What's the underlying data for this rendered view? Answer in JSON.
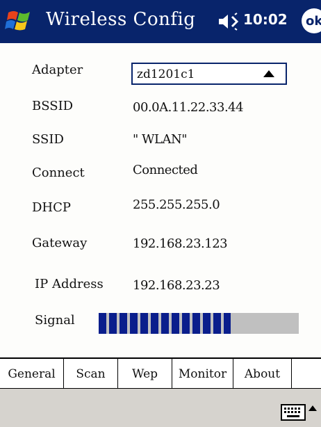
{
  "titlebar": {
    "title": "Wireless Config",
    "time": "10:02",
    "ok_label": "ok",
    "icons": [
      "windows-start-icon",
      "speaker-icon"
    ],
    "accent_color": "#08246b"
  },
  "form": {
    "adapter": {
      "label": "Adapter",
      "value": "zd1201c1"
    },
    "bssid": {
      "label": "BSSID",
      "value": "00.0A.11.22.33.44"
    },
    "ssid": {
      "label": "SSID",
      "value": "\" WLAN\""
    },
    "connect": {
      "label": "Connect",
      "value": "Connected"
    },
    "dhcp": {
      "label": "DHCP",
      "value": "255.255.255.0"
    },
    "gateway": {
      "label": "Gateway",
      "value": "192.168.23.123"
    },
    "ip": {
      "label": "IP Address",
      "value": "192.168.23.23"
    },
    "signal": {
      "label": "Signal",
      "level_fraction": 0.66,
      "bar_color": "#0a1e8c",
      "track_color": "#c0c0c0"
    }
  },
  "tabs": [
    {
      "label": "General"
    },
    {
      "label": "Scan"
    },
    {
      "label": "Wep"
    },
    {
      "label": "Monitor"
    },
    {
      "label": "About"
    }
  ],
  "menubar": {
    "icons": [
      "keyboard-icon",
      "sip-arrow-icon"
    ]
  }
}
